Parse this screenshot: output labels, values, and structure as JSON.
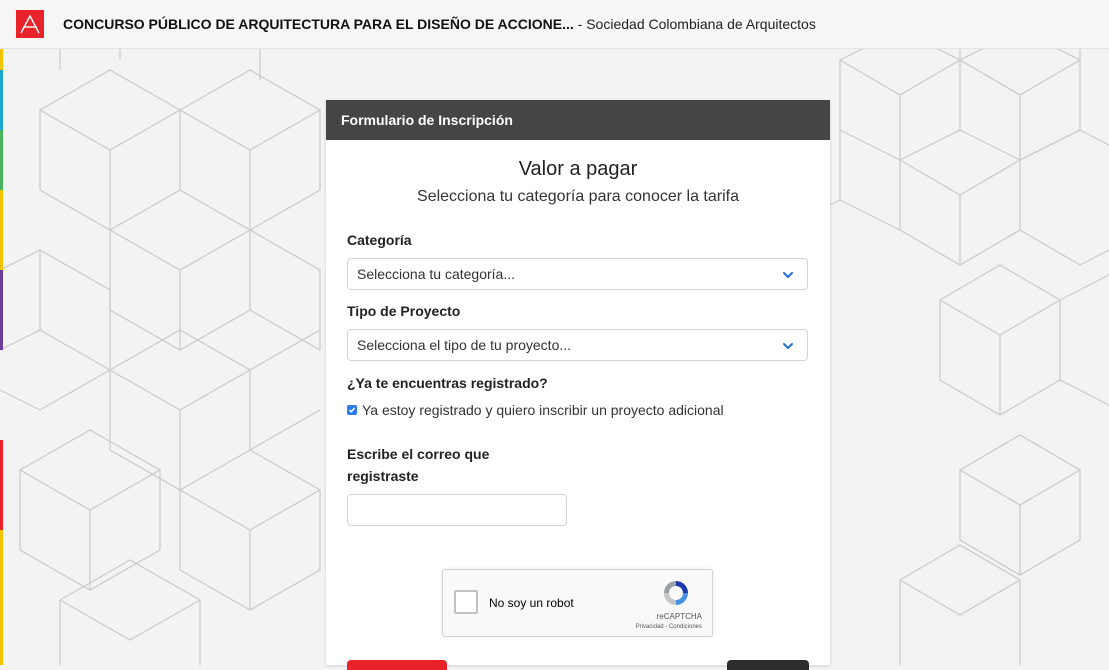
{
  "header": {
    "title": "CONCURSO PÚBLICO DE ARQUITECTURA PARA EL DISEÑO DE ACCIONE...",
    "subtitle": " - Sociedad Colombiana de Arquitectos",
    "logo_icon": "sca-logo-icon"
  },
  "form": {
    "header_title": "Formulario de Inscripción",
    "heading": "Valor a pagar",
    "subheading": "Selecciona tu categoría para conocer la tarifa",
    "category_label": "Categoría",
    "category_placeholder": "Selecciona tu categoría...",
    "project_type_label": "Tipo de Proyecto",
    "project_type_placeholder": "Selecciona el tipo de tu proyecto...",
    "registered_question": "¿Ya te encuentras registrado?",
    "registered_checkbox_label": "Ya estoy registrado y quiero inscribir un proyecto adicional",
    "registered_checked": true,
    "email_label_line1": "Escribe el correo que",
    "email_label_line2": "registraste",
    "email_value": ""
  },
  "recaptcha": {
    "label": "No soy un robot",
    "brand": "reCAPTCHA",
    "terms": "Privacidad - Condiciones"
  },
  "colors": {
    "brand_red": "#e8242a",
    "header_dark": "#454545",
    "checkbox_blue": "#2f7bf0",
    "chevron_blue": "#1f6fd6"
  }
}
